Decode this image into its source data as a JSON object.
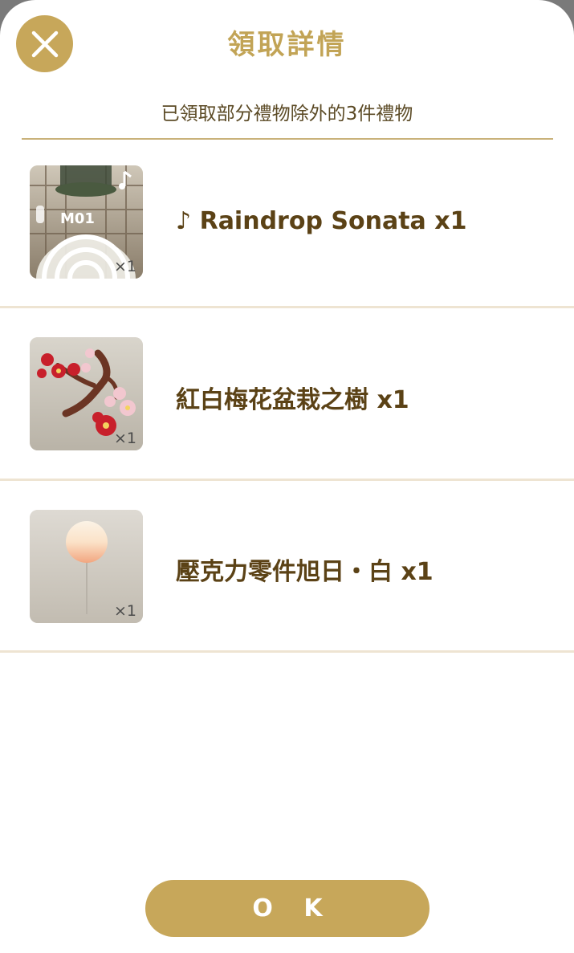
{
  "dialog": {
    "title": "領取詳情",
    "subtitle": "已領取部分禮物除外的3件禮物",
    "ok_label": "O K"
  },
  "items": [
    {
      "name": "♪ Raindrop Sonata x1",
      "qty": "×1",
      "badge": "M01",
      "icon": "music-track-thumbnail"
    },
    {
      "name": "紅白梅花盆栽之樹 x1",
      "qty": "×1",
      "icon": "plum-blossom-bonsai-thumbnail"
    },
    {
      "name": "壓克力零件旭日・白 x1",
      "qty": "×1",
      "icon": "acrylic-sunrise-part-thumbnail"
    }
  ],
  "colors": {
    "accent": "#c7a75a",
    "title": "#c2a456",
    "text": "#5b4216",
    "separator": "#eee4d2"
  }
}
